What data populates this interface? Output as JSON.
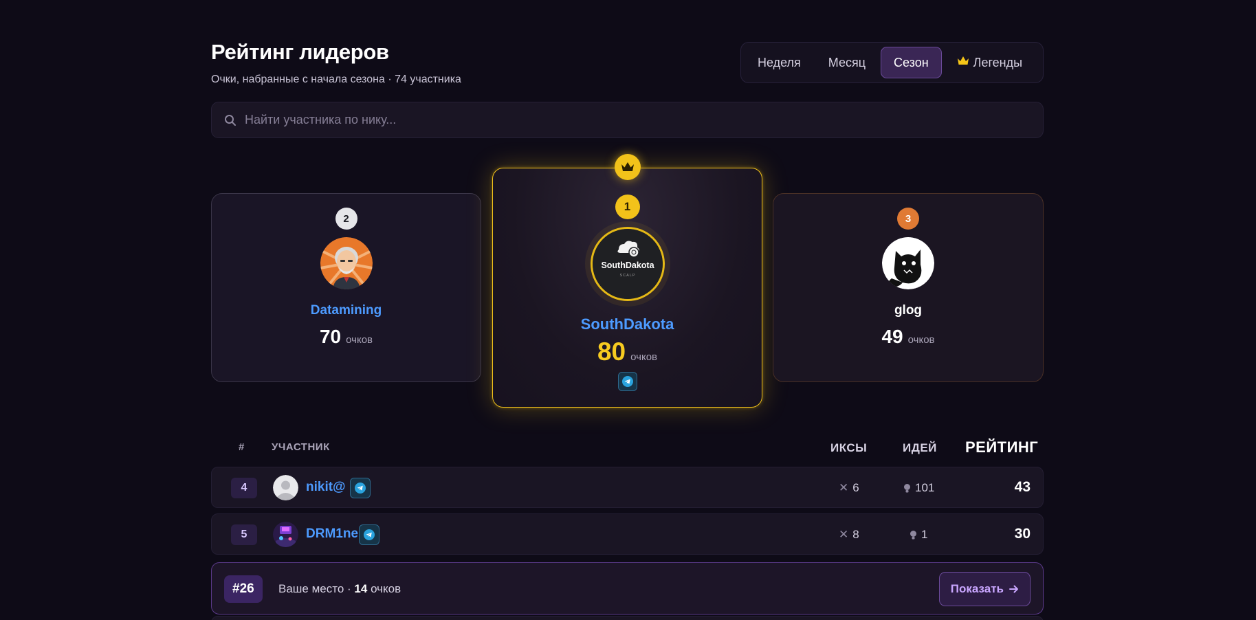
{
  "header": {
    "title": "Рейтинг лидеров",
    "subtitle": "Очки, набранные с начала сезона · 74 участника"
  },
  "tabs": [
    {
      "label": "Неделя",
      "active": false
    },
    {
      "label": "Месяц",
      "active": false
    },
    {
      "label": "Сезон",
      "active": true
    },
    {
      "label": "Легенды",
      "active": false,
      "icon": "crown-icon"
    }
  ],
  "search": {
    "placeholder": "Найти участника по нику...",
    "value": ""
  },
  "podium": {
    "first": {
      "place": "1",
      "name": "SouthDakota",
      "score": "80",
      "unit": "очков",
      "avatar_text": "SouthDakota",
      "avatar_sub": "SCALP"
    },
    "second": {
      "place": "2",
      "name": "Datamining",
      "score": "70",
      "unit": "очков"
    },
    "third": {
      "place": "3",
      "name": "glog",
      "score": "49",
      "unit": "очков"
    }
  },
  "table": {
    "headers": {
      "rank": "#",
      "user": "УЧАСТНИК",
      "x": "ИКСЫ",
      "ideas": "ИДЕЙ",
      "rating": "РЕЙТИНГ"
    },
    "rows": [
      {
        "rank": "4",
        "name": "nikit@",
        "x": "6",
        "ideas": "101",
        "rating": "43"
      },
      {
        "rank": "5",
        "name": "DRM1ne",
        "x": "8",
        "ideas": "1",
        "rating": "30"
      }
    ]
  },
  "my_place": {
    "rank": "#26",
    "label": "Ваше место · ",
    "points": "14",
    "points_unit": " очков",
    "button_label": "Показать",
    "button_icon": "arrow-right-icon"
  },
  "colors": {
    "background": "#0e0b17",
    "accent_purple": "#6b4a9a",
    "gold": "#f2c21a",
    "silver": "#e6e6ea",
    "bronze": "#e07a34",
    "link_blue": "#4d9bff"
  }
}
